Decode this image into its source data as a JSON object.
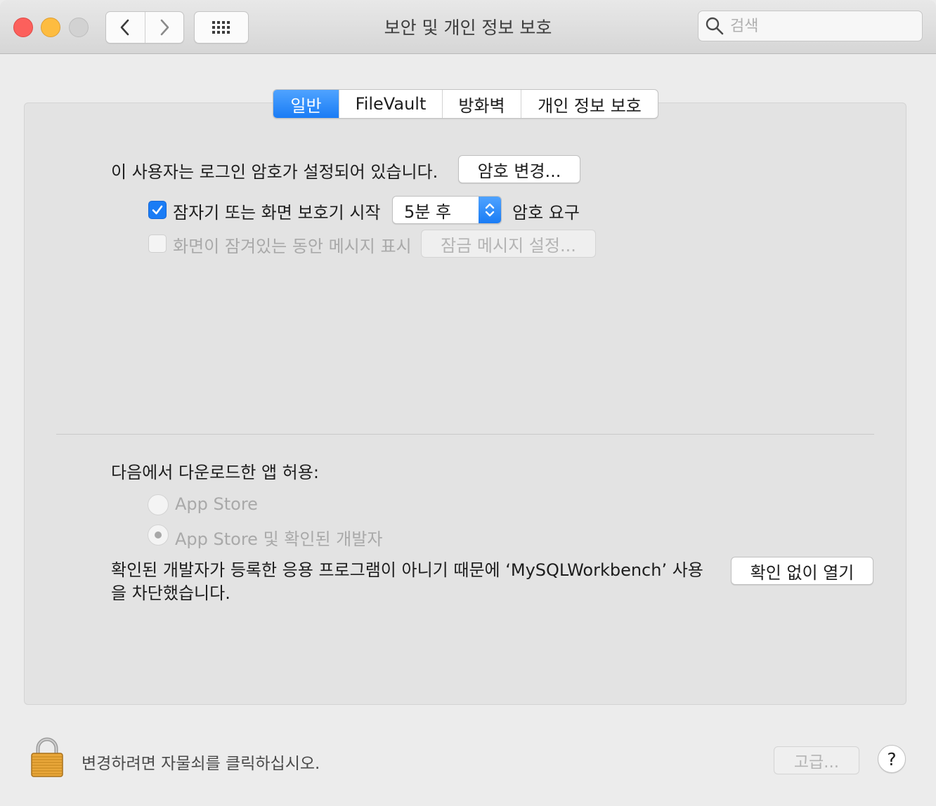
{
  "window": {
    "title": "보안 및 개인 정보 보호",
    "search_placeholder": "검색"
  },
  "tabs": [
    {
      "label": "일반",
      "active": true
    },
    {
      "label": "FileVault",
      "active": false
    },
    {
      "label": "방화벽",
      "active": false
    },
    {
      "label": "개인 정보 보호",
      "active": false
    }
  ],
  "general": {
    "password_set_text": "이 사용자는 로그인 암호가 설정되어 있습니다.",
    "change_password_button": "암호 변경...",
    "require_password": {
      "checked": true,
      "label": "잠자기 또는 화면 보호기 시작",
      "select_value": "5분 후",
      "suffix": "암호 요구"
    },
    "lock_message": {
      "checked": false,
      "enabled": false,
      "label": "화면이 잠겨있는 동안 메시지 표시",
      "button": "잠금 메시지 설정..."
    }
  },
  "downloads": {
    "heading": "다음에서 다운로드한 앱 허용:",
    "options": [
      {
        "label": "App Store",
        "selected": false
      },
      {
        "label": "App Store 및 확인된 개발자",
        "selected": true
      }
    ],
    "blocked_message": "확인된 개발자가 등록한 응용 프로그램이 아니기 때문에 ‘MySQLWorkbench’ 사용을 차단했습니다.",
    "open_anyway_button": "확인 없이 열기"
  },
  "footer": {
    "lock_message": "변경하려면 자물쇠를 클릭하십시오.",
    "advanced_button": "고급...",
    "help_button": "?"
  },
  "colors": {
    "accent": "#1a7cf5",
    "close": "#fc605c",
    "minimize": "#fdbc40",
    "zoom_disabled": "#d2d2d2"
  }
}
